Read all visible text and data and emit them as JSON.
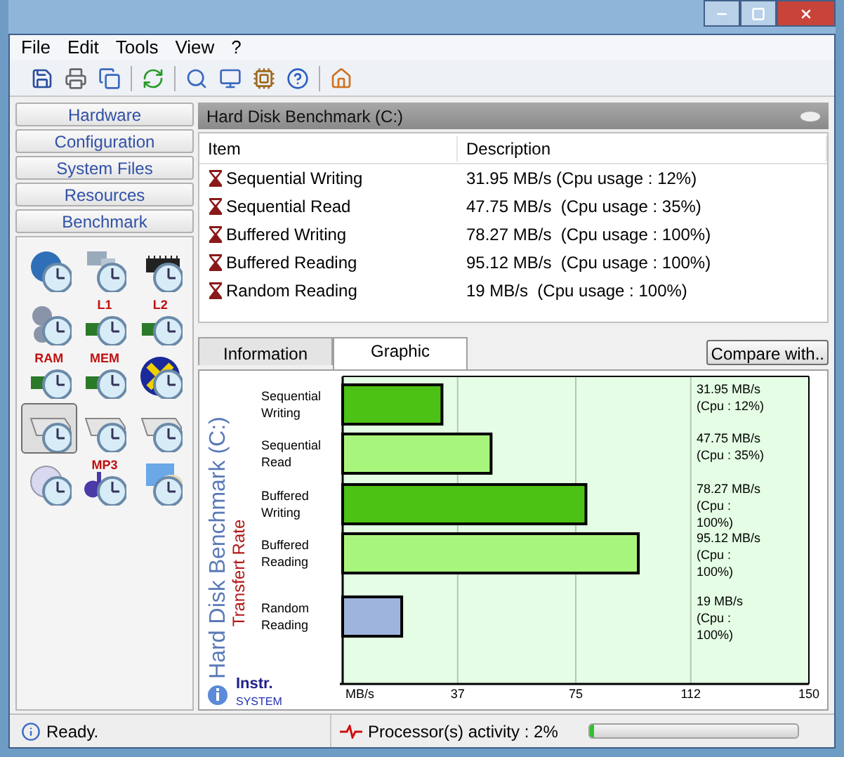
{
  "window": {
    "controls": [
      {
        "kind": "minimize"
      },
      {
        "kind": "maximize"
      },
      {
        "kind": "close"
      }
    ]
  },
  "menu": [
    "File",
    "Edit",
    "Tools",
    "View",
    "?"
  ],
  "toolbar": [
    {
      "kind": "save"
    },
    {
      "kind": "print"
    },
    {
      "kind": "copy"
    },
    {
      "kind": "sep"
    },
    {
      "kind": "refresh"
    },
    {
      "kind": "sep"
    },
    {
      "kind": "search"
    },
    {
      "kind": "network"
    },
    {
      "kind": "board"
    },
    {
      "kind": "help"
    },
    {
      "kind": "sep"
    },
    {
      "kind": "home"
    }
  ],
  "sidebar": {
    "sections": [
      "Hardware",
      "Configuration",
      "System Files",
      "Resources",
      "Benchmark"
    ],
    "tools": [
      {
        "kind": "globe",
        "selected": false
      },
      {
        "kind": "computer",
        "selected": false
      },
      {
        "kind": "chip",
        "selected": false
      },
      {
        "kind": "gears",
        "selected": false
      },
      {
        "kind": "memory",
        "label": "L1",
        "selected": false
      },
      {
        "kind": "memory",
        "label": "L2",
        "selected": false
      },
      {
        "kind": "memory",
        "label": "RAM",
        "selected": false
      },
      {
        "kind": "memory",
        "label": "MEM",
        "selected": false
      },
      {
        "kind": "cross",
        "selected": false
      },
      {
        "kind": "drive",
        "selected": true
      },
      {
        "kind": "drive",
        "selected": false
      },
      {
        "kind": "drive",
        "selected": false
      },
      {
        "kind": "disc",
        "selected": false
      },
      {
        "kind": "music",
        "label": "MP3",
        "selected": false
      },
      {
        "kind": "palette",
        "selected": false
      }
    ]
  },
  "panel": {
    "title": "Hard Disk Benchmark (C:)",
    "table": {
      "columns": [
        "Item",
        "Description"
      ],
      "rows": [
        {
          "item": "Sequential Writing",
          "description": "31.95 MB/s (Cpu usage : 12%)"
        },
        {
          "item": "Sequential Read",
          "description": "47.75 MB/s  (Cpu usage : 35%)"
        },
        {
          "item": "Buffered Writing",
          "description": "78.27 MB/s  (Cpu usage : 100%)"
        },
        {
          "item": "Buffered Reading",
          "description": "95.12 MB/s  (Cpu usage : 100%)"
        },
        {
          "item": "Random Reading",
          "description": "19 MB/s  (Cpu usage : 100%)"
        }
      ]
    },
    "tabs": [
      {
        "label": "Information",
        "selected": false
      },
      {
        "label": "Graphic",
        "selected": true
      }
    ],
    "compare_button": "Compare with..",
    "chart_data": {
      "type": "bar",
      "orientation": "horizontal",
      "title": "Hard Disk Benchmark (C:)",
      "ylabel": "Transfert Rate",
      "categories": [
        "Sequential Writing",
        "Sequential Read",
        "Buffered Writing",
        "Buffered Reading",
        "Random Reading"
      ],
      "series": [
        {
          "color": "#4cc214",
          "values": [
            31.95,
            null,
            78.27,
            null,
            null
          ]
        },
        {
          "color": "#a8f57c",
          "values": [
            null,
            47.75,
            null,
            95.12,
            null
          ]
        },
        {
          "color": "#9fb4dc",
          "values": [
            null,
            null,
            null,
            null,
            19
          ]
        }
      ],
      "grid": true,
      "xlim": [
        0,
        150
      ],
      "xticks": [
        {
          "value": 0,
          "label": "MB/s"
        },
        37,
        75,
        112,
        150
      ],
      "value_labels": [
        [
          "31.95  MB/s",
          "(Cpu : 12%)"
        ],
        [
          "47.75  MB/s",
          "(Cpu : 35%)"
        ],
        [
          "78.27  MB/s",
          "(Cpu :",
          "100%)"
        ],
        [
          "95.12  MB/s",
          "(Cpu :",
          "100%)"
        ],
        [
          "19 MB/s",
          "(Cpu :",
          "100%)"
        ]
      ]
    },
    "brand": [
      "Instr.",
      "SYSTEM"
    ]
  },
  "status_bar": {
    "text": "Ready.",
    "activity": "Processor(s) activity : 2%",
    "level": 0.02
  }
}
